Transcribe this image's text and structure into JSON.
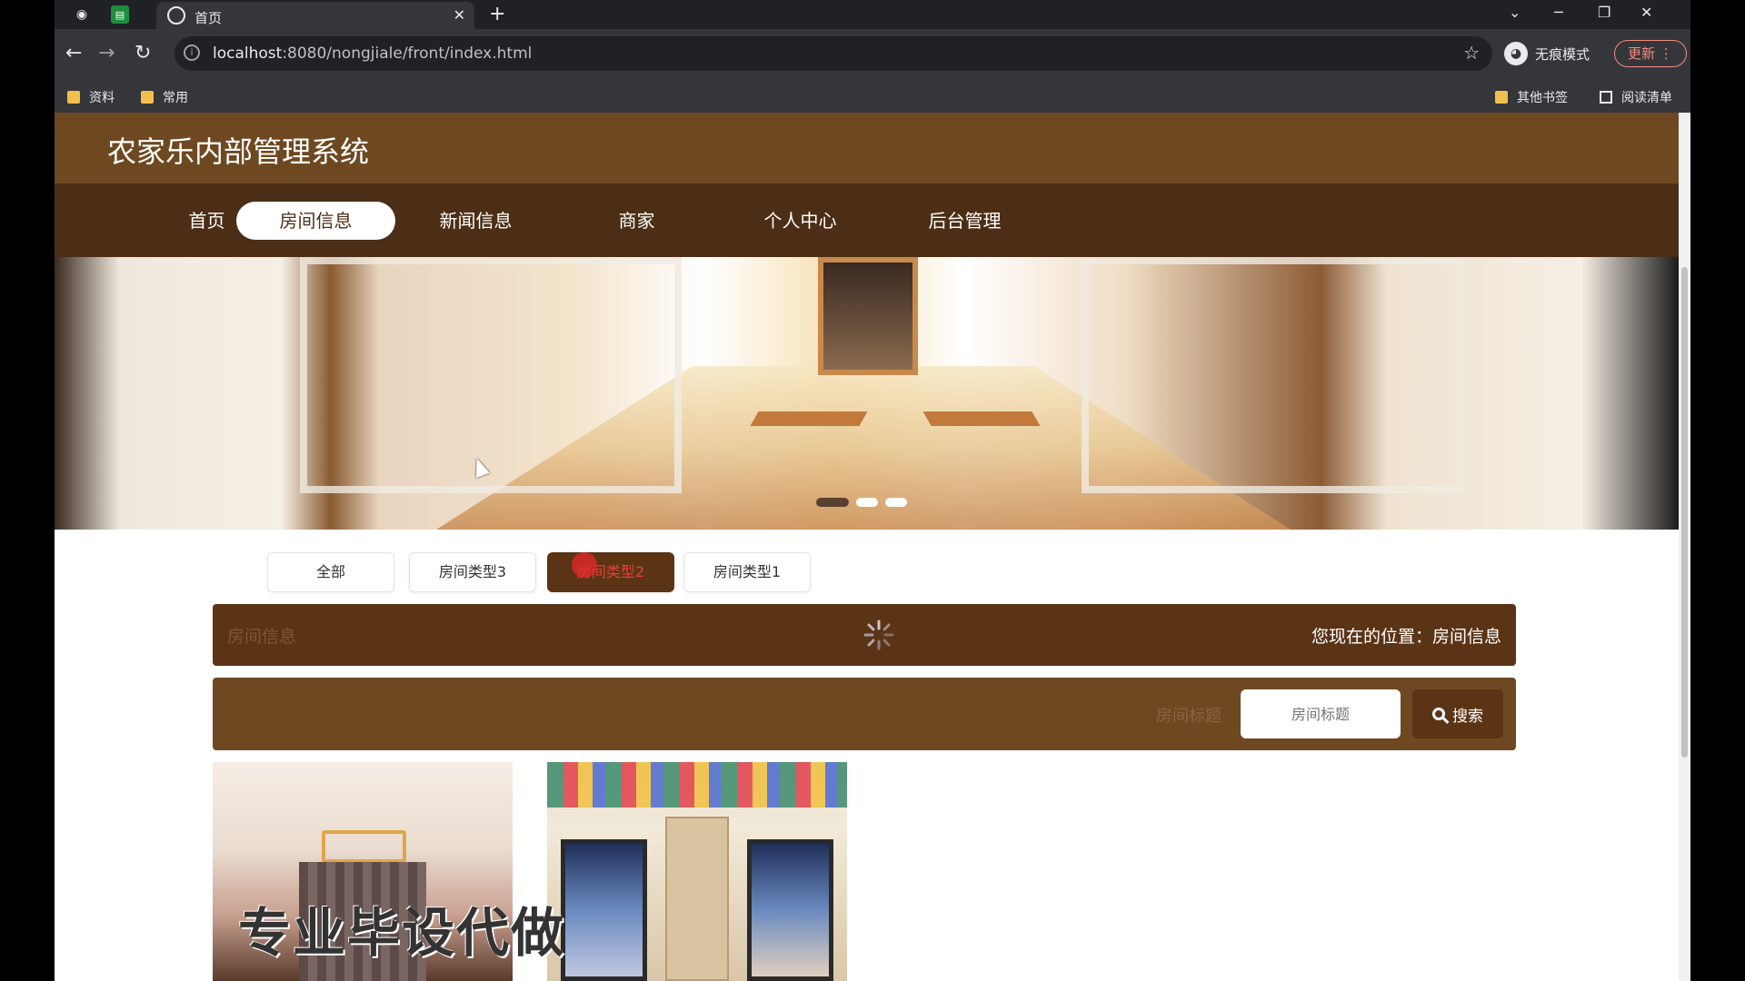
{
  "browser": {
    "tab_title": "首页",
    "url_host": "localhost",
    "url_rest": ":8080/nongjiale/front/index.html",
    "incognito_label": "无痕模式",
    "update_label": "更新",
    "bookmarks": [
      "资料",
      "常用"
    ],
    "other_bookmarks": "其他书签",
    "reading_list": "阅读清单"
  },
  "site": {
    "title": "农家乐内部管理系统",
    "nav": [
      "首页",
      "房间信息",
      "新闻信息",
      "商家",
      "个人中心",
      "后台管理"
    ],
    "nav_active": "房间信息"
  },
  "filters": {
    "items": [
      "全部",
      "房间类型3",
      "房间类型2",
      "房间类型1"
    ],
    "active": "房间类型2"
  },
  "section": {
    "title": "房间信息",
    "breadcrumb": "您现在的位置：房间信息"
  },
  "search": {
    "label": "房间标题",
    "placeholder": "房间标题",
    "button": "搜索"
  },
  "watermark": "专业毕设代做",
  "colors": {
    "header": "#6e4820",
    "nav": "#4b2e15",
    "accent": "#5b3416"
  }
}
